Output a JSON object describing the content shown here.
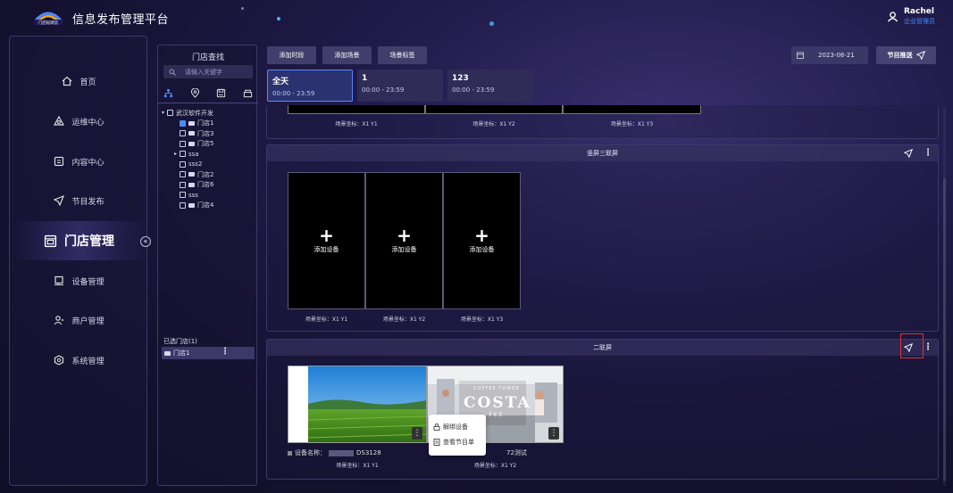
{
  "app": {
    "title": "信息发布管理平台",
    "logo_text": "门店标牌云"
  },
  "user": {
    "name": "Rachel",
    "role": "企业管理员"
  },
  "sidebar": {
    "items": [
      {
        "label": "首页",
        "icon": "home-icon"
      },
      {
        "label": "运维中心",
        "icon": "ops-icon"
      },
      {
        "label": "内容中心",
        "icon": "content-icon"
      },
      {
        "label": "节目发布",
        "icon": "send-icon"
      },
      {
        "label": "门店管理",
        "icon": "store-icon",
        "active": true
      },
      {
        "label": "设备管理",
        "icon": "device-icon"
      },
      {
        "label": "商户管理",
        "icon": "merchant-icon"
      },
      {
        "label": "系统管理",
        "icon": "settings-icon"
      }
    ],
    "collapse": "«"
  },
  "store_panel": {
    "title": "门店查找",
    "search_placeholder": "请输入关键字",
    "tree": [
      {
        "label": "武汉软件开发",
        "level": 0,
        "expander": "▾",
        "checked": false
      },
      {
        "label": "门店1",
        "level": 1,
        "checked": true,
        "store": true
      },
      {
        "label": "门店3",
        "level": 1,
        "checked": false,
        "store": true
      },
      {
        "label": "门店5",
        "level": 1,
        "checked": false,
        "store": true
      },
      {
        "label": "ssa",
        "level": 1,
        "expander": "▸",
        "checked": false
      },
      {
        "label": "sss2",
        "level": 1,
        "checked": false
      },
      {
        "label": "门店2",
        "level": 1,
        "checked": false,
        "store": true
      },
      {
        "label": "门店6",
        "level": 1,
        "checked": false,
        "store": true
      },
      {
        "label": "sss",
        "level": 1,
        "checked": false
      },
      {
        "label": "门店4",
        "level": 1,
        "checked": false,
        "store": true
      }
    ],
    "selected_title": "已选门店(1)",
    "selected_item": "门店1",
    "selected_more": "⋮"
  },
  "toolbar": {
    "add_period": "添加时段",
    "add_scene": "添加场景",
    "scene_tag": "场景标签",
    "date": "2023-08-21",
    "push": "节目推送"
  },
  "periods": [
    {
      "name": "全天",
      "time": "00:00 - 23:59",
      "active": true
    },
    {
      "name": "1",
      "time": "00:00 - 23:59"
    },
    {
      "name": "123",
      "time": "00:00 - 23:59"
    }
  ],
  "top_section": {
    "coords": [
      "场景坐标：X1 Y1",
      "场景坐标：X1 Y2",
      "场景坐标：X1 Y3"
    ]
  },
  "vertical_section": {
    "title": "竖屏三联屏",
    "add_label": "添加设备",
    "plus": "+",
    "coords": [
      "场景坐标：X1 Y1",
      "场景坐标：X1 Y2",
      "场景坐标：X1 Y3"
    ]
  },
  "dual_section": {
    "title": "二联屏",
    "device1_name": "设备名称：",
    "device1_suffix": "DS3128",
    "device2_suffix": "72测试",
    "coords": [
      "场景坐标：X1 Y1",
      "场景坐标：X1 Y2"
    ],
    "brand_top": "COFFEE TOWER",
    "brand": "COSTA",
    "brand_sub": "FEE",
    "more": "⋮"
  },
  "context_menu": {
    "unbind": "解绑设备",
    "view_program": "查看节目单"
  },
  "colors": {
    "accent": "#4a8cff",
    "highlight": "#e23030",
    "bg": "#1f1a48"
  }
}
